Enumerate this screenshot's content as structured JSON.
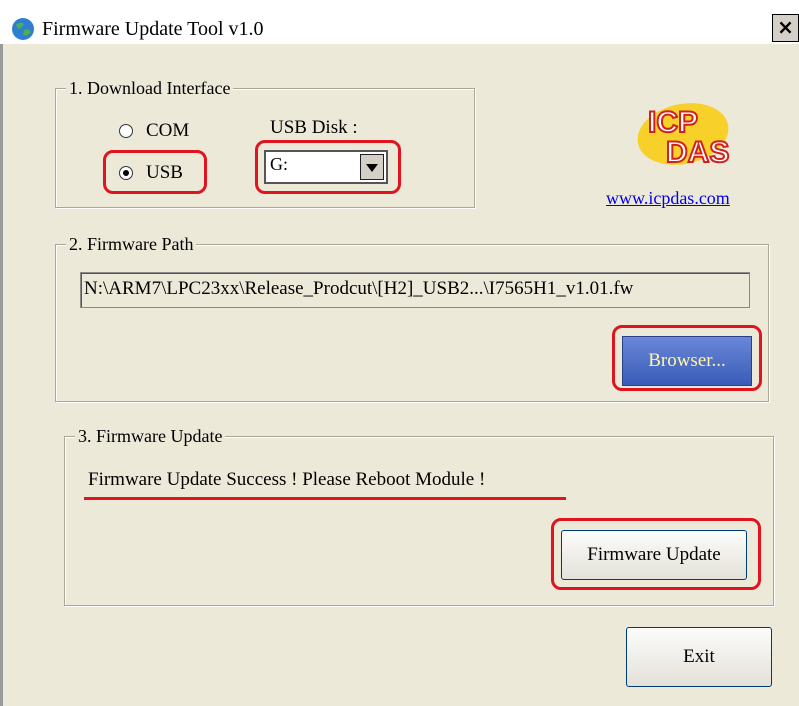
{
  "window": {
    "title": "Firmware Update Tool v1.0",
    "close_label": "×"
  },
  "download_interface": {
    "legend": "1. Download Interface",
    "com_label": "COM",
    "usb_label": "USB",
    "selected": "USB",
    "usb_disk_label": "USB Disk :",
    "usb_disk_value": "G:"
  },
  "brand": {
    "logo_top": "ICP",
    "logo_bottom": "DAS",
    "link": "www.icpdas.com"
  },
  "firmware_path": {
    "legend": "2. Firmware Path",
    "value": "N:\\ARM7\\LPC23xx\\Release_Prodcut\\[H2]_USB2...\\I7565H1_v1.01.fw",
    "browse_label": "Browser..."
  },
  "firmware_update": {
    "legend": "3. Firmware Update",
    "status": "Firmware Update Success !  Please Reboot Module !",
    "update_label": "Firmware Update"
  },
  "exit_label": "Exit",
  "colors": {
    "highlight": "#e0141e",
    "browse_button": "#4a6cc8"
  }
}
